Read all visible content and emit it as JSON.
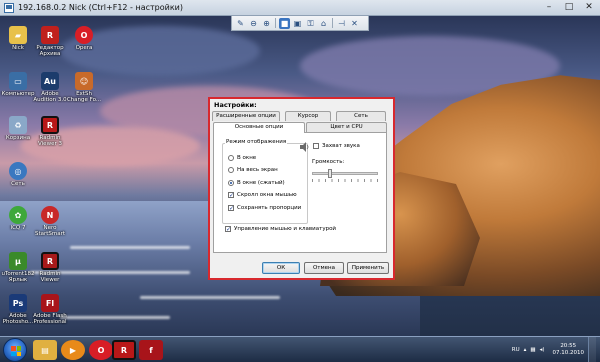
{
  "window": {
    "title": "192.168.0.2 Nick       (Ctrl+F12 - настройки)",
    "controls": {
      "minimize": "–",
      "maximize": "□",
      "close": "✕"
    }
  },
  "toolbar": {
    "buttons": [
      "wrench-icon",
      "zoom-out-icon",
      "zoom-in-icon",
      "fullscreen-icon",
      "fit-window-icon",
      "lock-icon",
      "home-icon",
      "pin-icon",
      "close-icon"
    ]
  },
  "desktop_icons": [
    {
      "label": "Nick",
      "color": "#e8c14a",
      "glyph": "📁"
    },
    {
      "label": "Редактор Архива",
      "color": "#c0201c",
      "glyph": "R"
    },
    {
      "label": "Opera",
      "color": "#d81e26",
      "glyph": "O"
    },
    {
      "label": "Компьютер",
      "color": "#3a6ea5",
      "glyph": "▭"
    },
    {
      "label": "Adobe Audition 3.0",
      "color": "#1c3c6c",
      "glyph": "Au"
    },
    {
      "label": "ExtSh Change Fo...",
      "color": "#c86a2a",
      "glyph": "☺"
    },
    {
      "label": "Корзина",
      "color": "#8aa8c8",
      "glyph": "🗑"
    },
    {
      "label": "Radmin Viewer 3",
      "color": "#b81818",
      "glyph": "R"
    },
    {
      "label": "Сеть",
      "color": "#3a78c0",
      "glyph": "◎"
    },
    {
      "label": "ICQ 7",
      "color": "#3ea83a",
      "glyph": "✿"
    },
    {
      "label": "Nero StartSmart",
      "color": "#c82828",
      "glyph": "N"
    },
    {
      "label": "uTorrent182 Ярлык",
      "color": "#3a8a2a",
      "glyph": "µ"
    },
    {
      "label": "Radmin Viewer",
      "color": "#a81a1a",
      "glyph": "R"
    },
    {
      "label": "Adobe Photosho...",
      "color": "#1a3a78",
      "glyph": "Ps"
    },
    {
      "label": "Adobe Flash Professional",
      "color": "#a8141a",
      "glyph": "Fl"
    }
  ],
  "dialog": {
    "title": "Настройки:",
    "tabs_row1": [
      "Расширенные опции",
      "Курсор",
      "Сеть"
    ],
    "tabs_row2": [
      "Основные опции",
      "Цвет и CPU"
    ],
    "group_title": "Режим отображения",
    "display_modes": [
      {
        "label": "В окне",
        "selected": false
      },
      {
        "label": "На весь экран",
        "selected": false
      },
      {
        "label": "В окне (сжатый)",
        "selected": true
      }
    ],
    "scroll_option": {
      "label": "Скролл окна мышью",
      "checked": true
    },
    "keep_ratio": {
      "label": "Сохранять пропорции",
      "checked": true
    },
    "capture_sound": {
      "label": "Захват звука",
      "checked": false
    },
    "volume_label": "Громкость:",
    "volume_level": 0.25,
    "mouse_keyboard": {
      "label": "Управление мышью и клавиатурой",
      "checked": true
    },
    "buttons": {
      "ok": "ОК",
      "cancel": "Отмена",
      "apply": "Применить"
    },
    "accent_color": "#d8282e"
  },
  "taskbar": {
    "apps": [
      {
        "name": "explorer",
        "color": "#e0b040",
        "glyph": "▤"
      },
      {
        "name": "media-player",
        "color": "#e88a1a",
        "glyph": "▶"
      },
      {
        "name": "opera",
        "color": "#d81e26",
        "glyph": "O"
      },
      {
        "name": "radmin",
        "color": "#b81818",
        "glyph": "R"
      },
      {
        "name": "flash",
        "color": "#a8141a",
        "glyph": "f"
      }
    ],
    "lang": "RU",
    "time": "20:55",
    "date": "07.10.2010"
  }
}
